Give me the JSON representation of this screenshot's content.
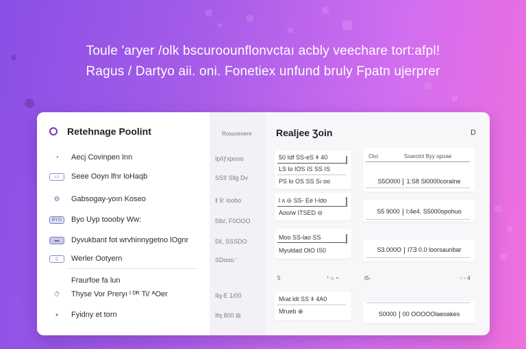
{
  "headline": {
    "line1": "Toule 'aryer /olk  bscuroounflonvctaı acbly veechare tort:afpl!",
    "line2": "Ragus / Dartyo aii. oni. Fonetiex unfund bruly Fpatn ujerprer"
  },
  "sidebar": {
    "title": "Retehnage Poolint",
    "items": [
      {
        "icon": "cloud-icon",
        "glyph": "◔",
        "label": "Aecj Covinpen Inn"
      },
      {
        "icon": "tag-icon",
        "glyph": "▭",
        "label": "Seee Ooyn lfnr loHaqb"
      },
      {
        "icon": "gear-icon",
        "glyph": "⚙",
        "label": "Gabsogay-yoın Koseo"
      },
      {
        "icon": "badge-icon",
        "glyph": "BYG",
        "label": "Byo Uyp toooby Ww:"
      },
      {
        "icon": "badge-dark-icon",
        "glyph": "▬",
        "label": "Dyvukbant fot wrvhinnygetno lOgnr"
      },
      {
        "icon": "window-icon",
        "glyph": "▯",
        "label": "Werler Ootyern"
      }
    ],
    "section_label": "Fraurfoe fa lun",
    "section_items": [
      {
        "icon": "timer-icon",
        "glyph": "⏱",
        "label": "Thyse Vor Preryı ᴵ ᴰᴿ Ti/ ᴬOer"
      },
      {
        "icon": "circle-icon",
        "glyph": "●",
        "label": "Fyidny et torn"
      }
    ]
  },
  "mid_column": {
    "header": "Rosuoeoere",
    "values": [
      "Ip/lƒxpooo",
      "SSII Sllg Dv",
      "‖ 9: loobo",
      "5Ib/, F0OOO",
      "5II, SSSDO",
      "SDooo.'",
      "Ilq-E 1/00",
      "Ifq 800  ⊞"
    ]
  },
  "main": {
    "title": "Realjee Ʒoin",
    "close_glyph": "D",
    "left_panels": [
      {
        "line1": "50 Idf SS-eS ǂ 40",
        "line2": "LS lo  IOS IS  SS IS",
        "line3": "PS lo OS SS  Sı oo"
      },
      {
        "line1": "l  ʌ  ⊖  SS- Ee I-ldo",
        "line2": "Aoo/w ITSED ⊖"
      },
      {
        "line1": "Moo  SS-lao SS",
        "line2": "Myuldad OtO  IS0"
      },
      {
        "line1": "Mıat ldt SS ǂ 4A0",
        "line2": "Mrueb ⊕"
      }
    ],
    "left_marks": {
      "a": "5",
      "b": "ᵗ ∩ ∘"
    },
    "right_panels": [
      {
        "head_left": "Cko",
        "head_right": "Soarcint Byy opoae",
        "row": "S5O000 | 1:S8 Sl0000coraIne"
      },
      {
        "row": "S5 9000 | I:4e4. S5000opohuo"
      },
      {
        "row": "S3.000O | I7Ǝ 0.0 loorsaunbar"
      },
      {
        "row": "S0000 | 00 OOOOOlaeoakes"
      }
    ],
    "right_marks": {
      "a": "t5-",
      "b": "◦ ◦ 4"
    }
  },
  "colors": {
    "bg_start": "#8a4fe6",
    "bg_end": "#f06fdc",
    "card": "#f7f7fa",
    "accent": "#7a2fb3"
  }
}
